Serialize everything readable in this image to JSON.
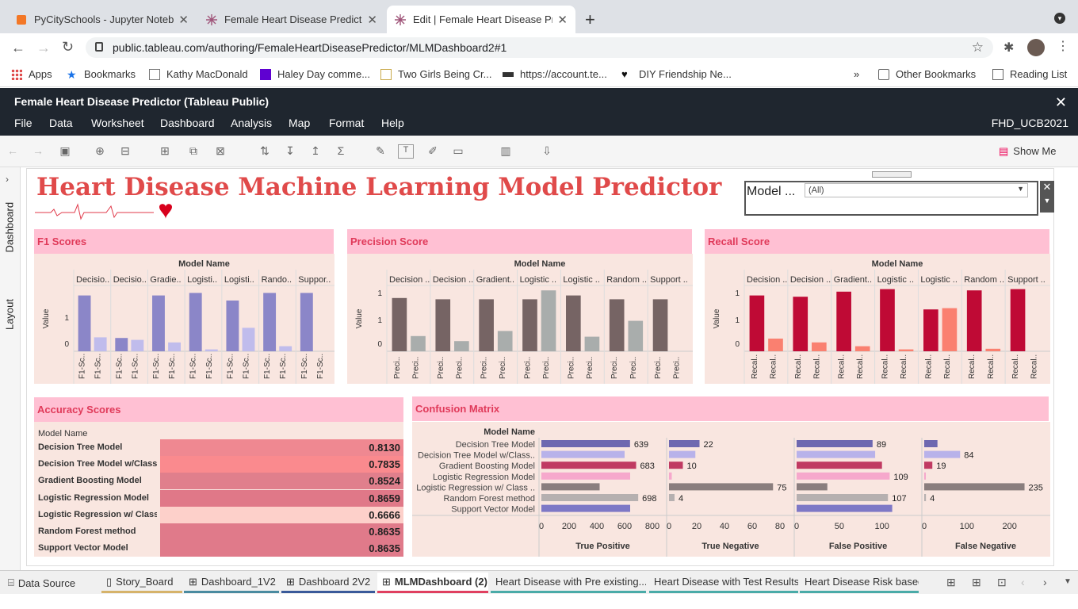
{
  "browser": {
    "tabs": [
      {
        "label": "PyCitySchools - Jupyter Noteb"
      },
      {
        "label": "Female Heart Disease Predicto"
      },
      {
        "label": "Edit | Female Heart Disease Pre"
      }
    ],
    "url": "public.tableau.com/authoring/FemaleHeartDiseasePredictor/MLMDashboard2#1",
    "bookmarks": [
      "Apps",
      "Bookmarks",
      "Kathy MacDonald",
      "Haley Day comme...",
      "Two Girls Being Cr...",
      "https://account.te...",
      "DIY Friendship Ne..."
    ],
    "other_bookmarks": "Other Bookmarks",
    "reading_list": "Reading List"
  },
  "app": {
    "title": "Female Heart Disease Predictor (Tableau Public)",
    "menu": [
      "File",
      "Data",
      "Worksheet",
      "Dashboard",
      "Analysis",
      "Map",
      "Format",
      "Help"
    ],
    "workbook": "FHD_UCB2021",
    "show_me": "Show Me"
  },
  "sidebar": {
    "dashboard": "Dashboard",
    "layout": "Layout"
  },
  "dashboard": {
    "title": "Heart Disease Machine Learning Model Predictor",
    "filter": {
      "label": "Model ...",
      "value": "(All)"
    }
  },
  "sheets": {
    "f1": "F1 Scores",
    "precision": "Precision Score",
    "recall": "Recall Score",
    "accuracy": "Accuracy Scores",
    "confusion": "Confusion Matrix",
    "model_name": "Model Name",
    "value": "Value"
  },
  "colors": {
    "f1_dark": "#8b86c8",
    "f1_light": "#c0bcec",
    "prec_dark": "#766464",
    "prec_light": "#a9adac",
    "rec_dark": "#bf0a35",
    "rec_light": "#fa8070"
  },
  "chart_data": [
    {
      "type": "bar",
      "title": "F1 Scores",
      "xlabel": "Model Name",
      "ylabel": "Value",
      "columns": [
        "Decisio..",
        "Decisio..",
        "Gradie..",
        "Logisti..",
        "Logisti..",
        "Rando..",
        "Suppor.."
      ],
      "bar_labels": [
        "F1-Sc..",
        "F1-Sc.."
      ],
      "ytick_labels": [
        "1",
        "0"
      ],
      "series": [
        {
          "values": [
            0.88,
            0.21,
            0.88,
            0.92,
            0.8,
            0.92,
            0.92
          ]
        },
        {
          "values": [
            0.22,
            0.18,
            0.14,
            0.03,
            0.37,
            0.08,
            0
          ]
        }
      ]
    },
    {
      "type": "bar",
      "title": "Precision Score",
      "xlabel": "Model Name",
      "ylabel": "Value",
      "columns": [
        "Decision ..",
        "Decision ..",
        "Gradient..",
        "Logistic ..",
        "Logistic ..",
        "Random ..",
        "Support .."
      ],
      "bar_labels": [
        "Preci..",
        "Preci.."
      ],
      "ytick_labels": [
        "1",
        "1",
        "0"
      ],
      "series": [
        {
          "values": [
            0.84,
            0.82,
            0.82,
            0.82,
            0.88,
            0.82,
            0.82
          ]
        },
        {
          "values": [
            0.24,
            0.16,
            0.32,
            0.96,
            0.23,
            0.48,
            0
          ]
        }
      ]
    },
    {
      "type": "bar",
      "title": "Recall Score",
      "xlabel": "Model Name",
      "ylabel": "Value",
      "columns": [
        "Decision ..",
        "Decision ..",
        "Gradient..",
        "Logistic ..",
        "Logistic ..",
        "Random ..",
        "Support .."
      ],
      "bar_labels": [
        "Recal..",
        "Recal.."
      ],
      "ytick_labels": [
        "1",
        "1",
        "0"
      ],
      "series": [
        {
          "values": [
            0.88,
            0.86,
            0.94,
            0.98,
            0.66,
            0.96,
            0.98
          ]
        },
        {
          "values": [
            0.2,
            0.14,
            0.08,
            0.03,
            0.68,
            0.04,
            0
          ]
        }
      ]
    },
    {
      "type": "table",
      "title": "Accuracy Scores",
      "column": "Model Name",
      "rows": [
        {
          "model": "Decision Tree Model",
          "value": "0.8130"
        },
        {
          "model": "Decision Tree Model w/Class..",
          "value": "0.7835"
        },
        {
          "model": "Gradient Boosting Model",
          "value": "0.8524"
        },
        {
          "model": "Logistic Regression Model",
          "value": "0.8659"
        },
        {
          "model": "Logistic Regression w/ Class..",
          "value": "0.6666"
        },
        {
          "model": "Random Forest method",
          "value": "0.8635"
        },
        {
          "model": "Support Vector Model",
          "value": "0.8635"
        }
      ]
    },
    {
      "type": "bar",
      "title": "Confusion Matrix",
      "xlabel": "Model Name",
      "models": [
        "Decision Tree Model",
        "Decision Tree Model w/Class..",
        "Gradient Boosting Model",
        "Logistic Regression Model",
        "Logistic Regression w/ Class ..",
        "Random Forest method",
        "Support Vector Model"
      ],
      "bar_colors": [
        "#6e68b0",
        "#b8b2ea",
        "#c03a62",
        "#f6a8cc",
        "#8a7e7e",
        "#b6b0b0",
        "#7e78c6"
      ],
      "panels": [
        {
          "name": "True Positive",
          "max": 800,
          "ticks": [
            "0",
            "200",
            "400",
            "600",
            "800"
          ],
          "values": [
            639,
            600,
            683,
            640,
            420,
            698,
            640
          ],
          "labels": [
            "639",
            "",
            "683",
            "",
            "",
            "698",
            ""
          ]
        },
        {
          "name": "True Negative",
          "max": 80,
          "ticks": [
            "0",
            "20",
            "40",
            "60",
            "80"
          ],
          "values": [
            22,
            19,
            10,
            2,
            75,
            4,
            0
          ],
          "labels": [
            "22",
            "",
            "10",
            "",
            "75",
            "4",
            ""
          ]
        },
        {
          "name": "False Positive",
          "max": 130,
          "ticks": [
            "0",
            "50",
            "100"
          ],
          "values": [
            89,
            92,
            100,
            109,
            36,
            107,
            112
          ],
          "labels": [
            "89",
            "",
            "",
            "109",
            "",
            "107",
            ""
          ]
        },
        {
          "name": "False Negative",
          "max": 260,
          "ticks": [
            "0",
            "100",
            "200"
          ],
          "values": [
            31,
            84,
            19,
            1,
            235,
            4,
            0
          ],
          "labels": [
            "",
            "84",
            "19",
            "",
            "235",
            "4",
            ""
          ]
        }
      ]
    }
  ],
  "sheet_tabs": [
    {
      "label": "Data Source"
    },
    {
      "label": "Story_Board"
    },
    {
      "label": "Dashboard_1V2"
    },
    {
      "label": "Dashboard 2V2"
    },
    {
      "label": "MLMDashboard (2)"
    },
    {
      "label": "Heart Disease with Pre existing..."
    },
    {
      "label": "Heart Disease with Test Results"
    },
    {
      "label": "Heart Disease Risk based on H"
    }
  ]
}
